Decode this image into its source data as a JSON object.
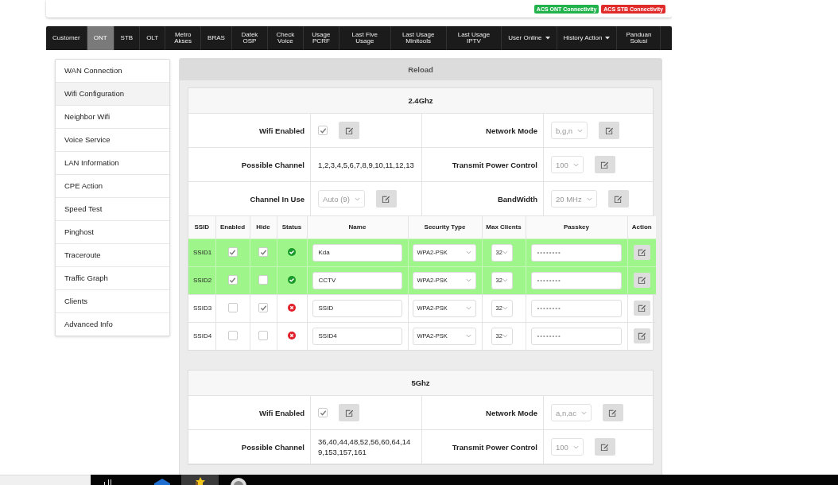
{
  "header": {
    "badges": [
      {
        "label": "ACS ONT Connectivity",
        "color": "#22b24c"
      },
      {
        "label": "ACS STB Connectivity",
        "color": "#e02b2b"
      }
    ]
  },
  "nav": [
    {
      "label": "Customer",
      "selected": false,
      "has_menu": false
    },
    {
      "label": "ONT",
      "selected": true,
      "has_menu": false
    },
    {
      "label": "STB",
      "selected": false,
      "has_menu": false
    },
    {
      "label": "OLT",
      "selected": false,
      "has_menu": false
    },
    {
      "label": "Metro Akses",
      "selected": false,
      "has_menu": false
    },
    {
      "label": "BRAS",
      "selected": false,
      "has_menu": false
    },
    {
      "label": "Datek OSP",
      "selected": false,
      "has_menu": false
    },
    {
      "label": "Check Voice",
      "selected": false,
      "has_menu": false
    },
    {
      "label": "Usage PCRF",
      "selected": false,
      "has_menu": false
    },
    {
      "label": "Last Five Usage",
      "selected": false,
      "has_menu": false
    },
    {
      "label": "Last Usage Minitools",
      "selected": false,
      "has_menu": false
    },
    {
      "label": "Last Usage IPTV",
      "selected": false,
      "has_menu": false
    },
    {
      "label": "User Online",
      "selected": false,
      "has_menu": true
    },
    {
      "label": "History Action",
      "selected": false,
      "has_menu": true
    },
    {
      "label": "Panduan Solusi",
      "selected": false,
      "has_menu": false
    }
  ],
  "sidebar": {
    "items": [
      {
        "label": "WAN Connection",
        "selected": false
      },
      {
        "label": "Wifi Configuration",
        "selected": true
      },
      {
        "label": "Neighbor Wifi",
        "selected": false
      },
      {
        "label": "Voice Service",
        "selected": false
      },
      {
        "label": "LAN Information",
        "selected": false
      },
      {
        "label": "CPE Action",
        "selected": false
      },
      {
        "label": "Speed Test",
        "selected": false
      },
      {
        "label": "Pinghost",
        "selected": false
      },
      {
        "label": "Traceroute",
        "selected": false
      },
      {
        "label": "Traffic Graph",
        "selected": false
      },
      {
        "label": "Clients",
        "selected": false
      },
      {
        "label": "Advanced Info",
        "selected": false
      }
    ]
  },
  "reload_button": "Reload",
  "sections": [
    {
      "title": "2.4Ghz",
      "settings": [
        {
          "label": "Wifi Enabled",
          "kind": "checkbox",
          "checked": true
        },
        {
          "label": "Network Mode",
          "kind": "select",
          "value": "b,g,n"
        },
        {
          "label": "Possible Channel",
          "kind": "text",
          "value": "1,2,3,4,5,6,7,8,9,10,11,12,13"
        },
        {
          "label": "Transmit Power Control",
          "kind": "select",
          "value": "100"
        },
        {
          "label": "Channel In Use",
          "kind": "select",
          "value": "Auto (9)"
        },
        {
          "label": "BandWidth",
          "kind": "select",
          "value": "20 MHz"
        }
      ],
      "ssid_table": {
        "columns": [
          "SSID",
          "Enabled",
          "Hide",
          "Status",
          "Name",
          "Security Type",
          "Max Clients",
          "Passkey",
          "Action"
        ],
        "rows": [
          {
            "ssid": "SSID1",
            "enabled": true,
            "hide": true,
            "active": true,
            "name": "Kda",
            "security": "WPA2-PSK",
            "max_clients": "32",
            "passkey_placeholder": "••••••••"
          },
          {
            "ssid": "SSID2",
            "enabled": true,
            "hide": false,
            "active": true,
            "name": "CCTV",
            "security": "WPA2-PSK",
            "max_clients": "32",
            "passkey_placeholder": "••••••••"
          },
          {
            "ssid": "SSID3",
            "enabled": false,
            "hide": true,
            "active": false,
            "name": "SSID",
            "security": "WPA2-PSK",
            "max_clients": "32",
            "passkey_placeholder": "••••••••"
          },
          {
            "ssid": "SSID4",
            "enabled": false,
            "hide": false,
            "active": false,
            "name": "SSID4",
            "security": "WPA2-PSK",
            "max_clients": "32",
            "passkey_placeholder": "••••••••"
          }
        ]
      }
    },
    {
      "title": "5Ghz",
      "settings": [
        {
          "label": "Wifi Enabled",
          "kind": "checkbox",
          "checked": true
        },
        {
          "label": "Network Mode",
          "kind": "select",
          "value": "a,n,ac"
        },
        {
          "label": "Possible Channel",
          "kind": "text",
          "value": "36,40,44,48,52,56,60,64,149,153,157,161"
        },
        {
          "label": "Transmit Power Control",
          "kind": "select",
          "value": "100"
        }
      ]
    }
  ]
}
